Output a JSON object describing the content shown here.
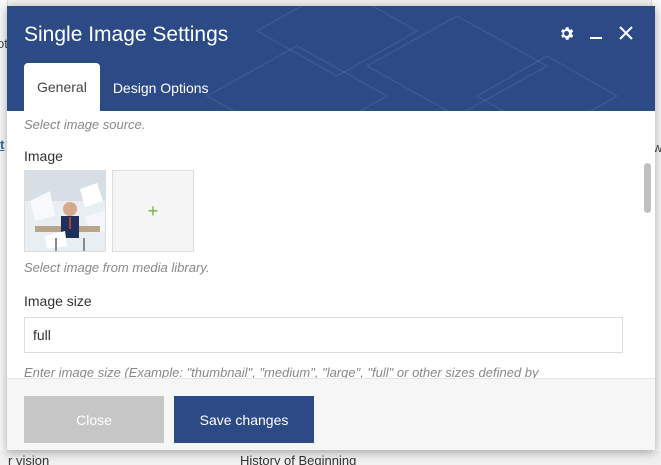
{
  "background": {
    "left_fragment": "ot",
    "link_fragment": "t",
    "right_fragment": "w",
    "bottom_left": "r vision",
    "bottom_right": "History of Beginning"
  },
  "modal": {
    "title": "Single Image Settings",
    "tabs": [
      {
        "label": "General",
        "active": true
      },
      {
        "label": "Design Options",
        "active": false
      }
    ],
    "controls": {
      "settings_icon": "gear-icon",
      "minimize_icon": "minimize-icon",
      "close_icon": "close-icon"
    },
    "colors": {
      "header": "#2b4a86",
      "save_button": "#2b4a86",
      "close_button": "#c6c6c6",
      "add_plus": "#6cb33f"
    }
  },
  "form": {
    "source_help": "Select image source.",
    "image_label": "Image",
    "add_symbol": "+",
    "image_help": "Select image from media library.",
    "size_label": "Image size",
    "size_value": "full",
    "size_help": "Enter image size (Example: \"thumbnail\", \"medium\", \"large\", \"full\" or other sizes defined by"
  },
  "footer": {
    "close_label": "Close",
    "save_label": "Save changes"
  }
}
